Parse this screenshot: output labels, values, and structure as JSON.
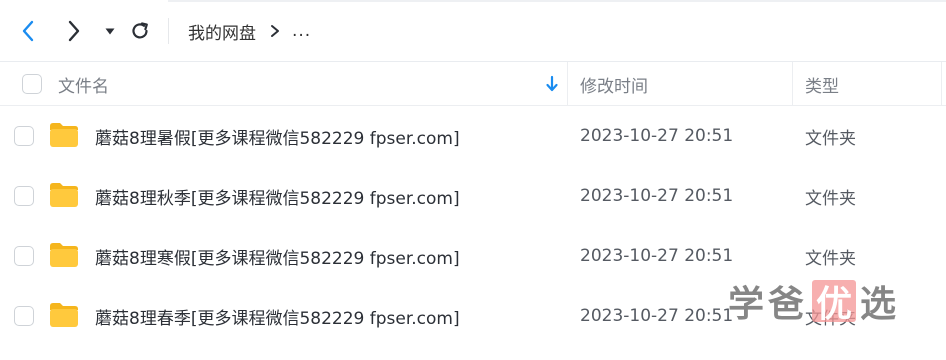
{
  "toolbar": {
    "back_icon": "chevron-left-icon",
    "forward_icon": "chevron-right-icon",
    "dropdown_icon": "caret-down-icon",
    "refresh_icon": "refresh-icon",
    "accent_color": "#1a8cf0"
  },
  "breadcrumb": {
    "root": "我的网盘",
    "more": "..."
  },
  "table": {
    "columns": {
      "name": "文件名",
      "modified": "修改时间",
      "type": "类型"
    },
    "sort_icon": "sort-down-icon",
    "rows": [
      {
        "name": "蘑菇8理暑假[更多课程微信582229 fpser.com]",
        "modified": "2023-10-27 20:51",
        "type": "文件夹",
        "icon": "folder-icon"
      },
      {
        "name": "蘑菇8理秋季[更多课程微信582229 fpser.com]",
        "modified": "2023-10-27 20:51",
        "type": "文件夹",
        "icon": "folder-icon"
      },
      {
        "name": "蘑菇8理寒假[更多课程微信582229 fpser.com]",
        "modified": "2023-10-27 20:51",
        "type": "文件夹",
        "icon": "folder-icon"
      },
      {
        "name": "蘑菇8理春季[更多课程微信582229 fpser.com]",
        "modified": "2023-10-27 20:51",
        "type": "文件夹",
        "icon": "folder-icon"
      }
    ]
  },
  "watermark": {
    "part1": "学爸",
    "boxed": "优",
    "part2": "选"
  },
  "colors": {
    "folder": "#ffc93d",
    "folder_dark": "#f5b51c"
  }
}
